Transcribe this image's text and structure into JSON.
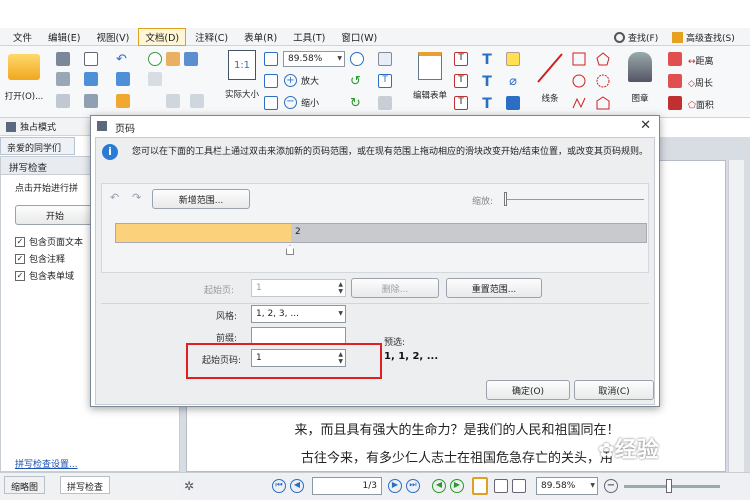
{
  "menu": {
    "items": [
      "文件",
      "编辑(E)",
      "视图(V)",
      "文档(D)",
      "注释(C)",
      "表单(R)",
      "工具(T)",
      "窗口(W)"
    ],
    "find": "查找(F)",
    "advanced_find": "高级查找(S)"
  },
  "ribbon": {
    "open": "打开(O)...",
    "zoom_value": "89.58%",
    "actual_size": "实际大小",
    "zoom_in": "放大",
    "zoom_out": "缩小",
    "edit_form": "编辑表单",
    "line": "线条",
    "stamp": "图章",
    "distance": "距离",
    "perimeter": "周长",
    "area": "面积"
  },
  "left": {
    "exclusive_mode": "独占模式",
    "doc_tab": "亲爱的同学们",
    "panel_title": "拼写检查",
    "instruction": "点击开始进行拼",
    "start_button": "开始",
    "opt_page_text": "包含页面文本",
    "opt_annotations": "包含注释",
    "opt_form_fields": "包含表单域",
    "settings_link": "拼写检查设置...",
    "tab_thumbnails": "缩略图",
    "tab_spellcheck": "拼写检查"
  },
  "document": {
    "line1": "来，而且具有强大的生命力？是我们的人民和祖国同在！",
    "line2": "古往今来，有多少仁人志士在祖国危急存亡的关头，用"
  },
  "status": {
    "page": "1/3",
    "zoom": "89.58%"
  },
  "dialog": {
    "title": "页码",
    "info": "您可以在下面的工具栏上通过双击来添加新的页码范围，或在现有范围上拖动相应的滑块改变开始/结束位置，或改变其页码规则。",
    "add_range": "新增范围...",
    "zoom_label": "缩放:",
    "range_end_label": "2",
    "range_fraction": 0.33,
    "start_page_label": "起始页:",
    "start_page_value": "1",
    "delete": "删除...",
    "reset_range": "重置范围...",
    "style_label": "风格:",
    "style_value": "1, 2, 3, ...",
    "prefix_label": "前缀:",
    "prefix_value": "",
    "start_number_label": "起始页码:",
    "start_number_value": "1",
    "preview_label": "预选:",
    "preview_value": "1, 1, 2, ...",
    "ok": "确定(O)",
    "cancel": "取消(C)"
  },
  "watermark": "经验",
  "colors": {
    "range_fill": "#fcd17b",
    "highlight": "#e02020",
    "info_icon": "#2a7bd6"
  }
}
